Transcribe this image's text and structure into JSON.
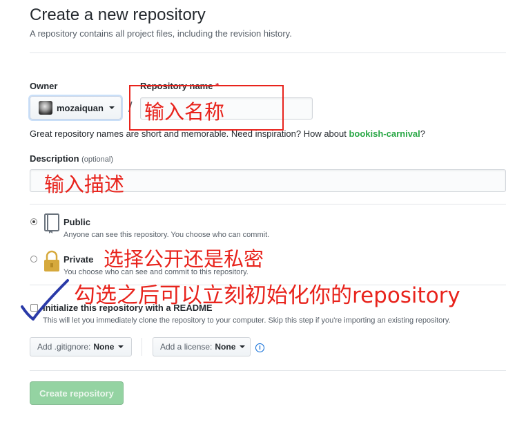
{
  "header": {
    "title": "Create a new repository",
    "subtitle": "A repository contains all project files, including the revision history."
  },
  "owner": {
    "label": "Owner",
    "value": "mozaiquan"
  },
  "repo": {
    "label": "Repository name",
    "required_mark": "*",
    "separator": "/",
    "value": ""
  },
  "hint": {
    "text": "Great repository names are short and memorable. Need inspiration? How about ",
    "suggestion": "bookish-carnival",
    "suffix": "?"
  },
  "description": {
    "label": "Description",
    "optional": "(optional)",
    "value": ""
  },
  "visibility": {
    "public": {
      "title": "Public",
      "desc": "Anyone can see this repository. You choose who can commit.",
      "selected": true
    },
    "private": {
      "title": "Private",
      "desc": "You choose who can see and commit to this repository.",
      "selected": false
    }
  },
  "readme": {
    "label": "Initialize this repository with a README",
    "desc": "This will let you immediately clone the repository to your computer. Skip this step if you're importing an existing repository.",
    "checked": false
  },
  "gitignore": {
    "label": "Add .gitignore:",
    "value": "None"
  },
  "license": {
    "label": "Add a license:",
    "value": "None"
  },
  "submit": {
    "label": "Create repository"
  },
  "annotations": {
    "name": "输入名称",
    "description": "输入描述",
    "visibility": "选择公开还是私密",
    "readme": "勾选之后可以立刻初始化你的repository"
  },
  "colors": {
    "annotation": "#e8231c",
    "create_button": "#94d3a2",
    "link_green": "#28a745",
    "checkmark": "#2a3aa8"
  },
  "icons": [
    "repo-book-icon",
    "lock-icon",
    "info-icon",
    "caret-down-icon"
  ]
}
